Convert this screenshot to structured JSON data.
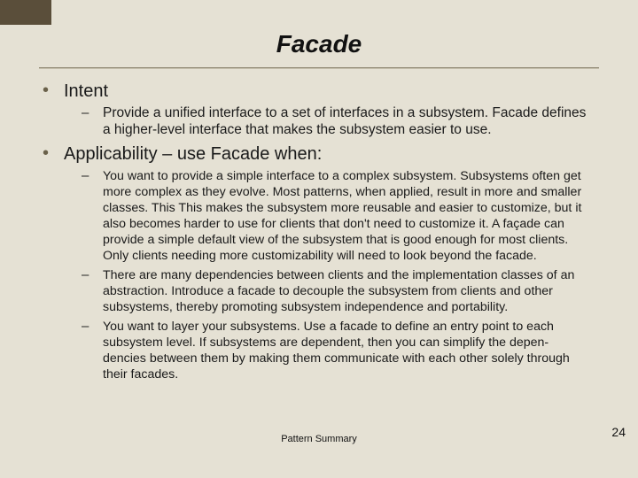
{
  "title": "Facade",
  "footer": "Pattern Summary",
  "page_number": "24",
  "sections": {
    "intent": {
      "label": "Intent",
      "bullet": "Provide a unified interface to a set of interfaces in a subsystem. Facade defines a higher-level interface that makes the subsystem easier to use."
    },
    "applicability": {
      "label": "Applicability – use Facade when:",
      "bullets": {
        "b1": "You want to provide a simple interface to a complex subsystem. Subsystems often get more complex as they evolve. Most patterns, when applied, result in more and smaller classes. This  This makes the subsystem more reusable and easier to customize, but it also becomes harder to use for clients that don't need to customize it. A façade can provide a simple default view of the subsystem that is good enough for most clients. Only clients needing more customizability will need to look beyond the facade.",
        "b2": "There are many dependencies between clients and the implementation classes of an abstraction. Introduce a facade to decouple the subsystem from clients and other subsystems, thereby promoting subsystem independence and portability.",
        "b3": "You want to layer your subsystems. Use a facade to define an entry point to each subsystem level. If subsystems are dependent, then you can simplify the depen-dencies between them by making them communicate with each other solely through their facades."
      }
    }
  }
}
